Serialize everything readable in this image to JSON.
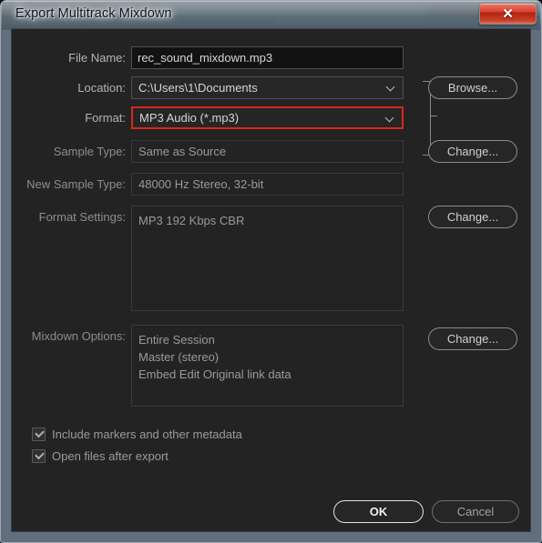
{
  "window": {
    "title": "Export Multitrack Mixdown",
    "close_glyph": "✕",
    "close_icon_name": "close-icon",
    "accent_highlight": "#d42a18",
    "body_bg": "#232323"
  },
  "form": {
    "file_name": {
      "label": "File Name:",
      "value": "rec_sound_mixdown.mp3",
      "placeholder": "rec_sound_mixdown.mp3"
    },
    "location": {
      "label": "Location:",
      "value": "C:\\Users\\1\\Documents"
    },
    "format": {
      "label": "Format:",
      "value": "MP3 Audio (*.mp3)",
      "highlighted": "true"
    },
    "sample_type": {
      "label": "Sample Type:",
      "value": "Same as Source"
    },
    "new_sample_type": {
      "label": "New Sample Type:",
      "value": "48000 Hz Stereo, 32-bit"
    },
    "format_settings": {
      "label": "Format Settings:",
      "value": "MP3 192 Kbps CBR"
    },
    "mixdown_options": {
      "label": "Mixdown Options:",
      "lines": [
        "Entire Session",
        "Master (stereo)",
        "Embed Edit Original link data"
      ]
    }
  },
  "buttons": {
    "browse": "Browse...",
    "change_sample_type": "Change...",
    "change_format_settings": "Change...",
    "change_mixdown_options": "Change...",
    "ok": "OK",
    "cancel": "Cancel"
  },
  "checkboxes": [
    {
      "label": "Include markers and other metadata",
      "checked": "true"
    },
    {
      "label": "Open files after export",
      "checked": "true"
    }
  ]
}
